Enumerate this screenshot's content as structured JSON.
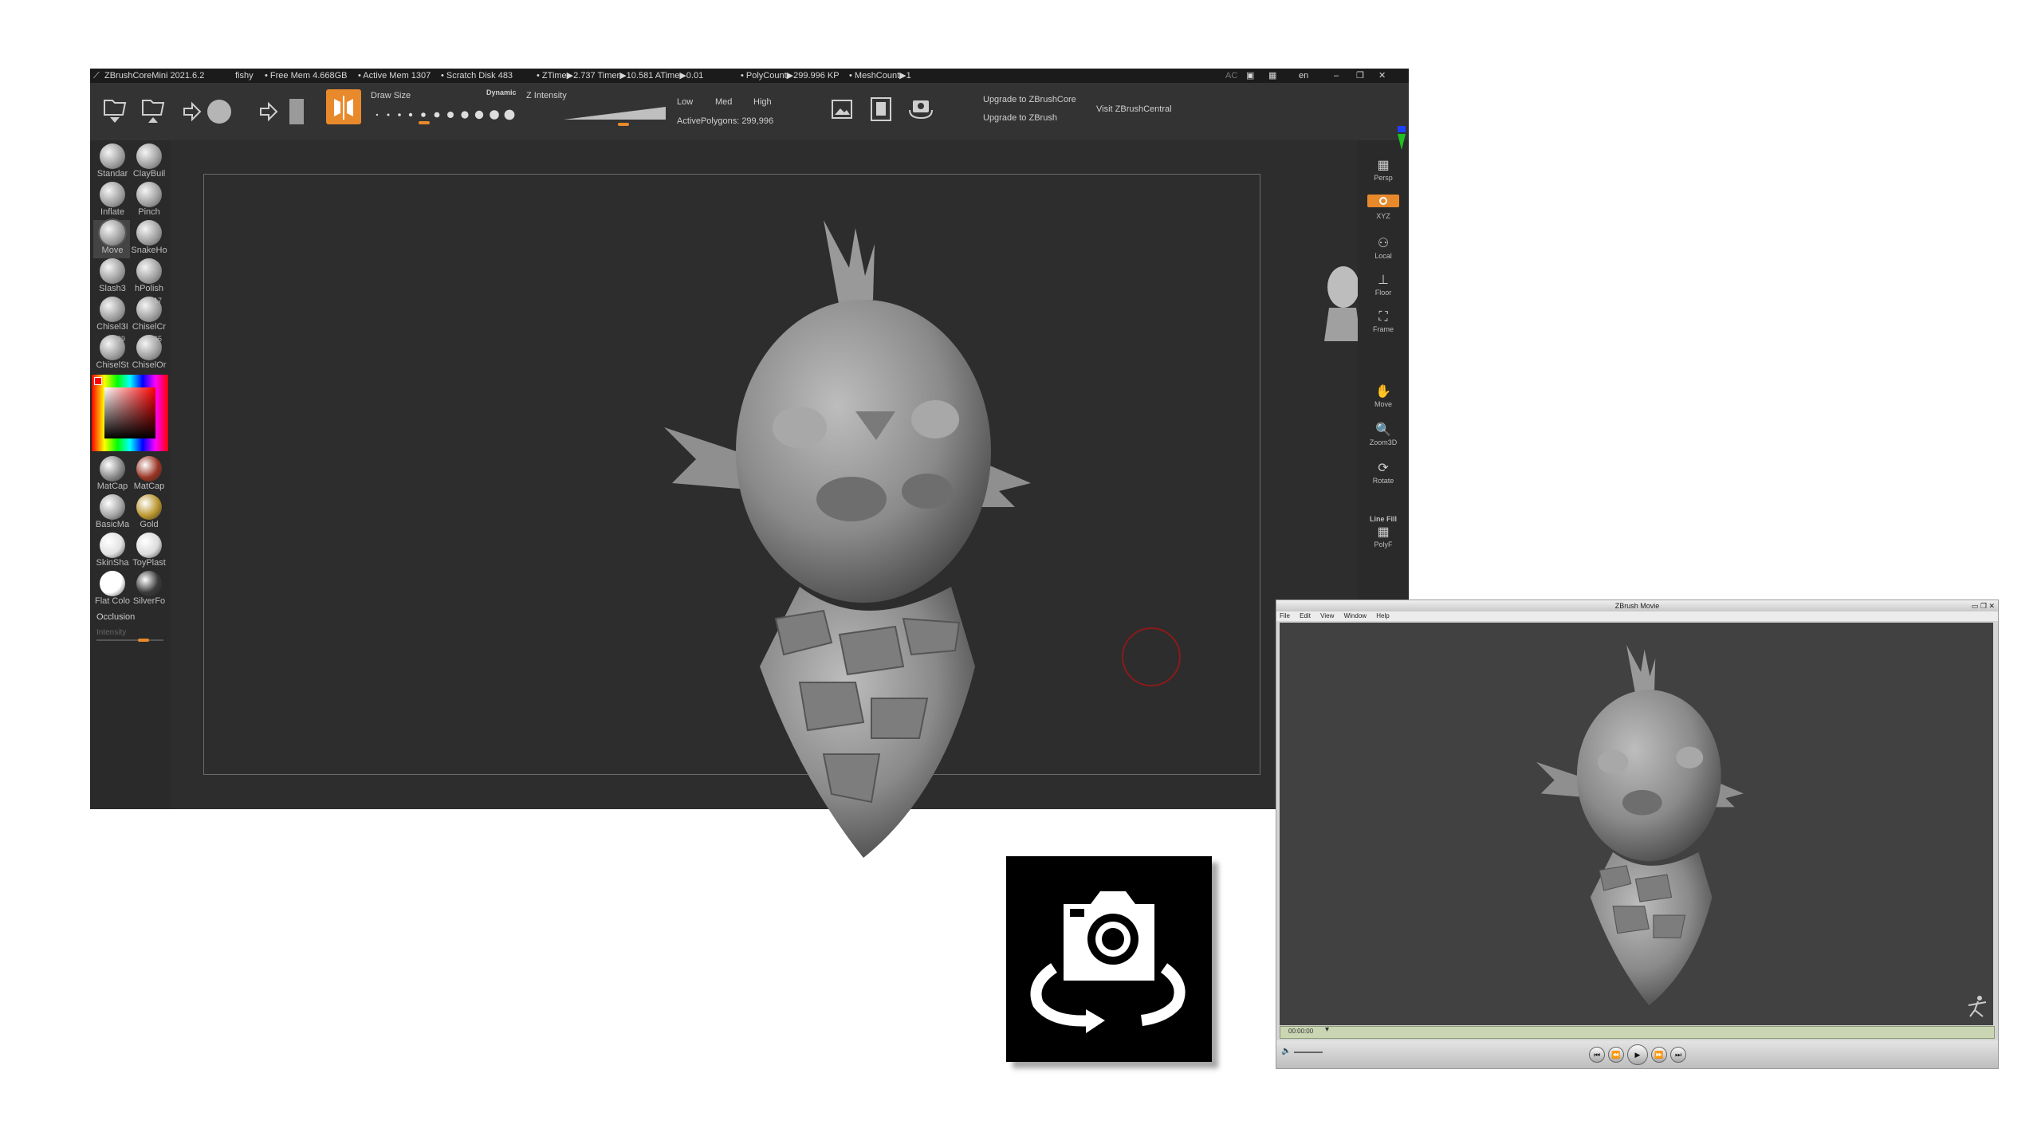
{
  "zbrush": {
    "title_bar": {
      "app": "ZBrushCoreMini 2021.6.2",
      "project": "fishy",
      "free_mem": "• Free Mem 4.668GB",
      "active_mem": "• Active Mem 1307",
      "scratch_disk": "• Scratch Disk 483",
      "ztime": "• ZTime▶2.737 Timer▶10.581 ATime▶0.01",
      "polycount": "• PolyCount▶299.996 KP",
      "meshcount": "• MeshCount▶1",
      "ac": "AC",
      "lang": "en"
    },
    "topbar": {
      "draw_size_label": "Draw Size",
      "dynamic_label": "Dynamic",
      "z_intensity_label": "Z Intensity",
      "low": "Low",
      "med": "Med",
      "high": "High",
      "active_polygons": "ActivePolygons: 299,996",
      "upgrade_core": "Upgrade to ZBrushCore",
      "upgrade_zbrush": "Upgrade to ZBrush",
      "visit_central": "Visit ZBrushCentral"
    },
    "brushes": [
      {
        "label": "Standar"
      },
      {
        "label": "ClayBuil"
      },
      {
        "label": "Inflate"
      },
      {
        "label": "Pinch"
      },
      {
        "label": "Move"
      },
      {
        "label": "SnakeHo"
      },
      {
        "label": "Slash3"
      },
      {
        "label": "hPolish"
      },
      {
        "label": "Chisel3I"
      },
      {
        "label": "ChiselCr"
      },
      {
        "label": "ChiselSt"
      },
      {
        "label": "ChiselOr"
      }
    ],
    "brush_badges": [
      "17",
      "29",
      "65"
    ],
    "materials": [
      {
        "label": "MatCap",
        "color": "#8a8a8a"
      },
      {
        "label": "MatCap",
        "color": "#9a3525"
      },
      {
        "label": "BasicMa",
        "color": "#a5a5a5"
      },
      {
        "label": "Gold",
        "color": "#b8952e"
      },
      {
        "label": "SkinSha",
        "color": "#e2e2e2"
      },
      {
        "label": "ToyPlast",
        "color": "#dcdcdc"
      },
      {
        "label": "Flat Colo",
        "color": "#ffffff"
      },
      {
        "label": "SilverFo",
        "color": "#3a3a3a"
      }
    ],
    "occlusion": "Occlusion",
    "intensity": "Intensity",
    "right_shelf": {
      "persp": "Persp",
      "xyz": "XYZ",
      "local": "Local",
      "floor": "Floor",
      "frame": "Frame",
      "move": "Move",
      "zoom3d": "Zoom3D",
      "rotate": "Rotate",
      "line_fill": "Line Fill",
      "polyf": "PolyF"
    },
    "accent_color": "#e8892b"
  },
  "movie": {
    "title": "ZBrush Movie",
    "menu": [
      "File",
      "Edit",
      "View",
      "Window",
      "Help"
    ],
    "timecode": "00:00:00",
    "timebar_color": "#c9d5b3"
  }
}
